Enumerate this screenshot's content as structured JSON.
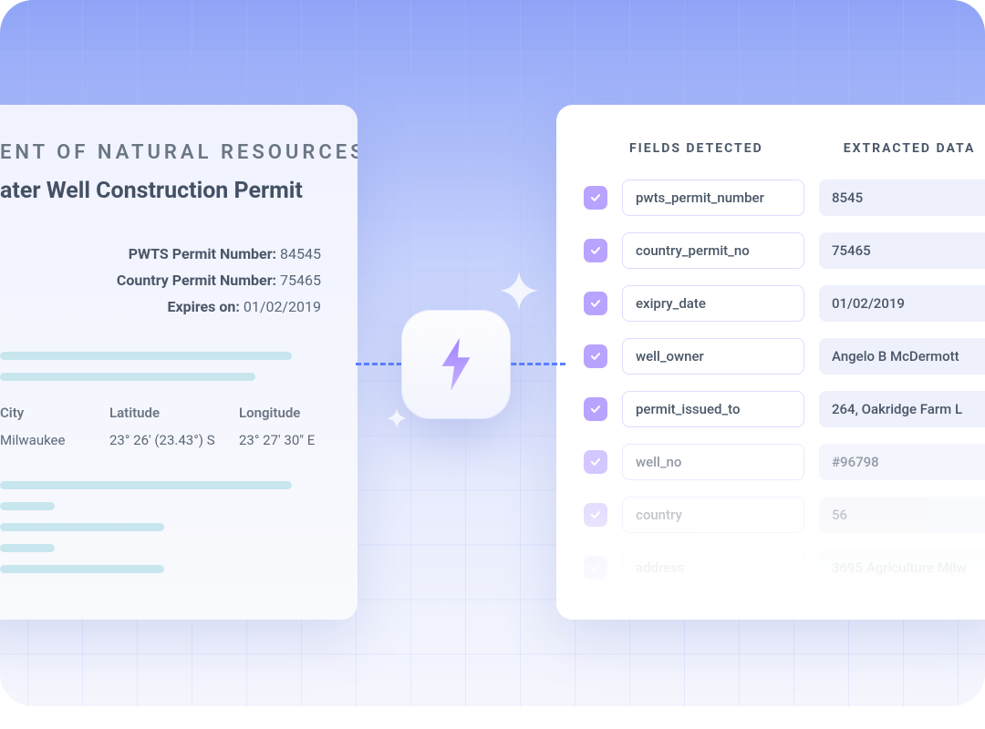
{
  "document": {
    "header": "ENT OF NATURAL RESOURCES",
    "title": "ater Well Construction Permit",
    "meta": [
      {
        "label": "PWTS Permit Number:",
        "value": "84545"
      },
      {
        "label": "Country Permit Number:",
        "value": "75465"
      },
      {
        "label": "Expires on:",
        "value": "01/02/2019"
      }
    ],
    "table": {
      "columns": [
        "City",
        "Latitude",
        "Longitude"
      ],
      "row": [
        "Milwaukee",
        "23° 26' (23.43°) S",
        "23° 27' 30\" E"
      ]
    }
  },
  "panel": {
    "col1": "FIELDS DETECTED",
    "col2": "EXTRACTED DATA",
    "rows": [
      {
        "field": "pwts_permit_number",
        "value": "8545"
      },
      {
        "field": "country_permit_no",
        "value": "75465"
      },
      {
        "field": "exipry_date",
        "value": "01/02/2019"
      },
      {
        "field": "well_owner",
        "value": "Angelo B McDermott"
      },
      {
        "field": "permit_issued_to",
        "value": "264, Oakridge Farm L"
      },
      {
        "field": "well_no",
        "value": "#96798"
      },
      {
        "field": "country",
        "value": "56"
      },
      {
        "field": "address",
        "value": "3695 Agriculture Milw"
      }
    ]
  }
}
